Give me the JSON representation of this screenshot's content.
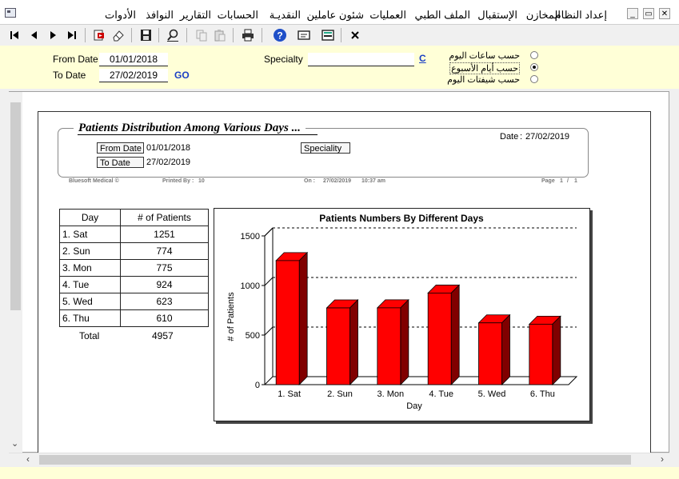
{
  "menu": {
    "items": [
      "إعداد النظام",
      "المخازن",
      "الإستقبال",
      "الملف الطبي",
      "العمليات",
      "شئون عاملين",
      "النقديـة",
      "الحسابات",
      "التقارير",
      "النوافذ",
      "الأدوات"
    ]
  },
  "window_controls": {
    "minimize": "_",
    "restore": "▭",
    "close": "✕"
  },
  "toolbar": {
    "buttons": [
      "first-record",
      "previous-record",
      "next-record",
      "last-record",
      "export",
      "eraser",
      "save",
      "find",
      "copy",
      "paste",
      "print",
      "help",
      "message",
      "layout",
      "close"
    ]
  },
  "filter": {
    "from_date_label": "From Date",
    "from_date_value": "01/01/2018",
    "to_date_label": "To Date",
    "to_date_value": "27/02/2019",
    "go_label": "GO",
    "specialty_label": "Specialty",
    "specialty_value": "",
    "c_link": "C",
    "radio_options": [
      {
        "label": "حسب ساعات اليوم",
        "selected": false
      },
      {
        "label": "حسب أيام الأسبوع",
        "selected": true
      },
      {
        "label": "حسب شيفتات اليوم",
        "selected": false
      }
    ]
  },
  "report": {
    "title": "Patients Distribution Among Various Days ...",
    "date_label": "Date",
    "date_value": "27/02/2019",
    "from_date_label": "From Date",
    "from_date_value": "01/01/2018",
    "to_date_label": "To Date",
    "to_date_value": "27/02/2019",
    "speciality_label": "Speciality",
    "footer": {
      "company": "Bluesoft Medical ©",
      "printed_by_label": "Printed By :",
      "printed_by_value": "10",
      "on_label": "On :",
      "on_date": "27/02/2019",
      "on_time": "10:37 am",
      "page_label": "Page",
      "page_current": "1",
      "page_sep": "/",
      "page_total": "1"
    },
    "table": {
      "headers": [
        "Day",
        "# of Patients"
      ],
      "rows": [
        {
          "day": "1. Sat",
          "count": "1251"
        },
        {
          "day": "2. Sun",
          "count": "774"
        },
        {
          "day": "3. Mon",
          "count": "775"
        },
        {
          "day": "4. Tue",
          "count": "924"
        },
        {
          "day": "5. Wed",
          "count": "623"
        },
        {
          "day": "6. Thu",
          "count": "610"
        }
      ],
      "total_label": "Total",
      "total_value": "4957"
    }
  },
  "chart_data": {
    "type": "bar",
    "title": "Patients Numbers By Different Days",
    "xlabel": "Day",
    "ylabel": "# of Patients",
    "categories": [
      "1. Sat",
      "2. Sun",
      "3. Mon",
      "4. Tue",
      "5. Wed",
      "6. Thu"
    ],
    "values": [
      1251,
      774,
      775,
      924,
      623,
      610
    ],
    "ylim": [
      0,
      1500
    ],
    "yticks": [
      0,
      500,
      1000,
      1500
    ],
    "grid": true,
    "bar_color": "#ff0000"
  },
  "colors": {
    "filter_background": "#ffffd7",
    "go_link": "#1a3fc4"
  }
}
